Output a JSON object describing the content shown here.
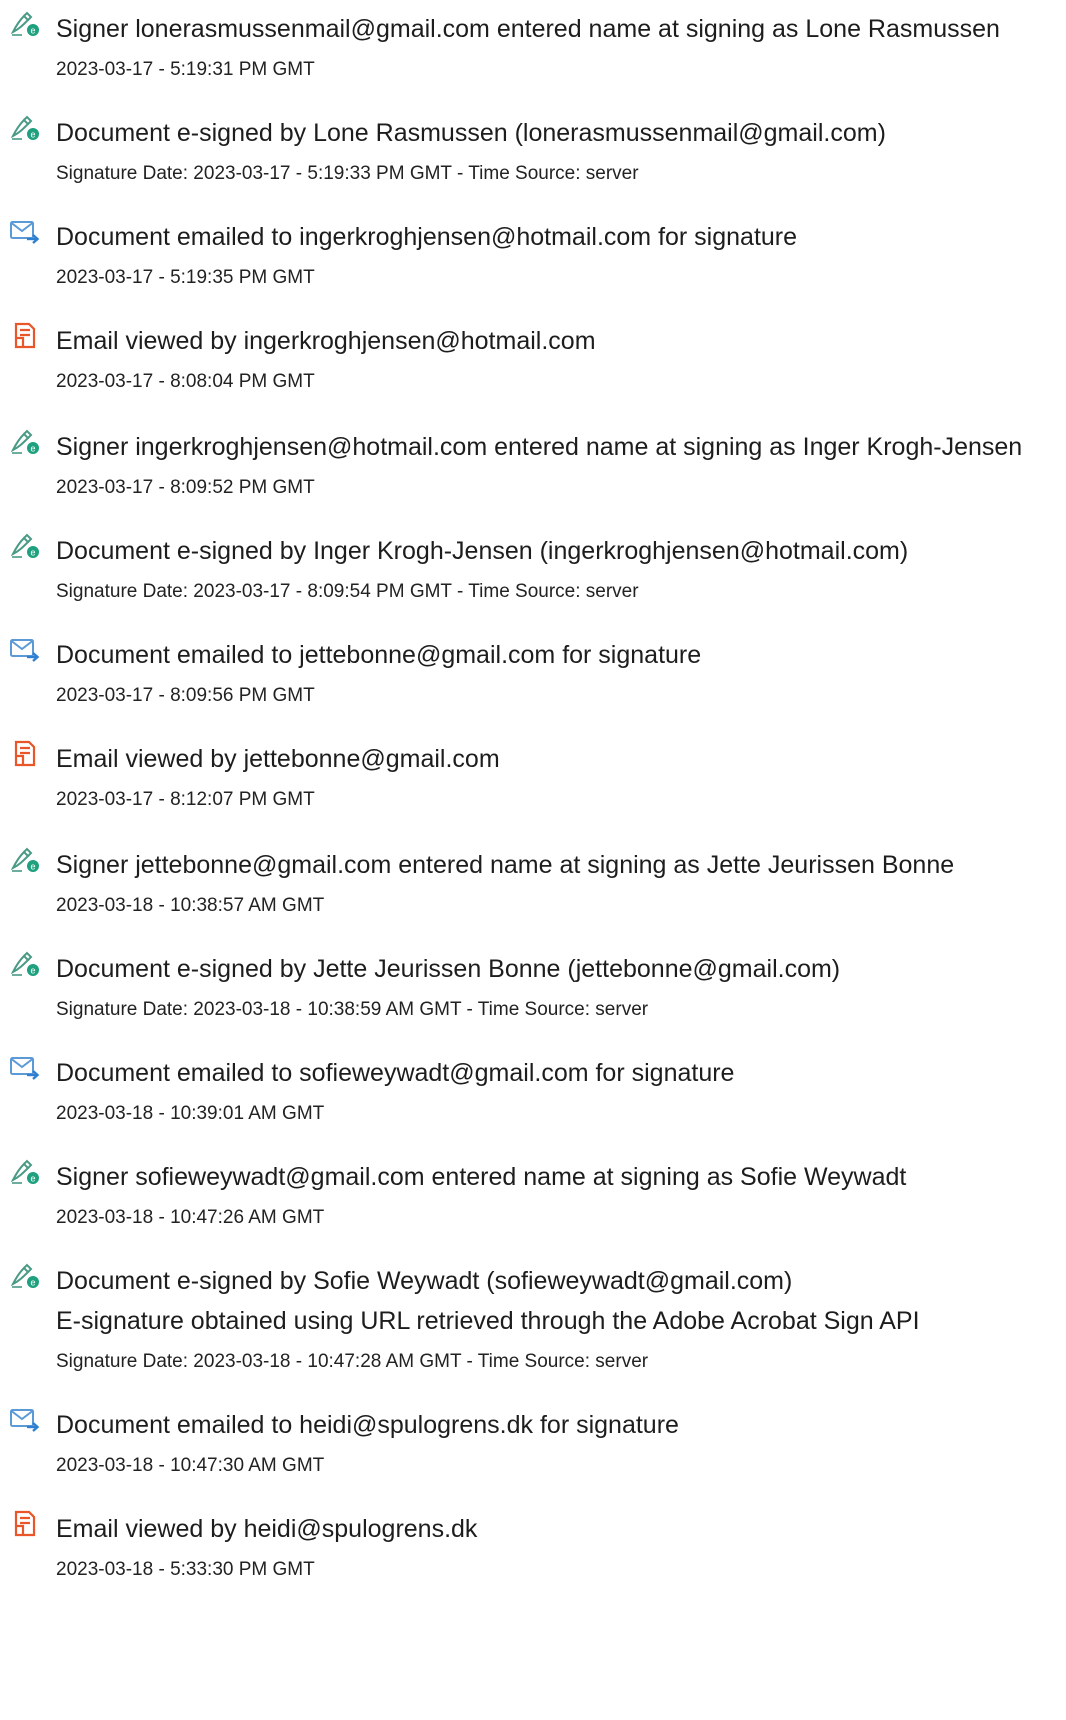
{
  "events": [
    {
      "icon": "sign-icon",
      "lines": [
        "Signer lonerasmussenmail@gmail.com entered name at signing as Lone Rasmussen"
      ],
      "meta": "2023-03-17 - 5:19:31 PM GMT"
    },
    {
      "icon": "sign-icon",
      "lines": [
        "Document e-signed by Lone Rasmussen (lonerasmussenmail@gmail.com)"
      ],
      "meta": "Signature Date: 2023-03-17 - 5:19:33 PM GMT - Time Source: server"
    },
    {
      "icon": "email-icon",
      "lines": [
        "Document emailed to ingerkroghjensen@hotmail.com for signature"
      ],
      "meta": "2023-03-17 - 5:19:35 PM GMT"
    },
    {
      "icon": "document-viewed-icon",
      "lines": [
        "Email viewed by ingerkroghjensen@hotmail.com"
      ],
      "meta": "2023-03-17 - 8:08:04 PM GMT"
    },
    {
      "icon": "sign-icon",
      "lines": [
        "Signer ingerkroghjensen@hotmail.com entered name at signing as Inger Krogh-Jensen"
      ],
      "meta": "2023-03-17 - 8:09:52 PM GMT"
    },
    {
      "icon": "sign-icon",
      "lines": [
        "Document e-signed by Inger Krogh-Jensen (ingerkroghjensen@hotmail.com)"
      ],
      "meta": "Signature Date: 2023-03-17 - 8:09:54 PM GMT - Time Source: server"
    },
    {
      "icon": "email-icon",
      "lines": [
        "Document emailed to jettebonne@gmail.com for signature"
      ],
      "meta": "2023-03-17 - 8:09:56 PM GMT"
    },
    {
      "icon": "document-viewed-icon",
      "lines": [
        "Email viewed by jettebonne@gmail.com"
      ],
      "meta": "2023-03-17 - 8:12:07 PM GMT"
    },
    {
      "icon": "sign-icon",
      "lines": [
        "Signer jettebonne@gmail.com entered name at signing as Jette Jeurissen Bonne"
      ],
      "meta": "2023-03-18 - 10:38:57 AM GMT"
    },
    {
      "icon": "sign-icon",
      "lines": [
        "Document e-signed by Jette Jeurissen Bonne (jettebonne@gmail.com)"
      ],
      "meta": "Signature Date: 2023-03-18 - 10:38:59 AM GMT - Time Source: server"
    },
    {
      "icon": "email-icon",
      "lines": [
        "Document emailed to sofieweywadt@gmail.com for signature"
      ],
      "meta": "2023-03-18 - 10:39:01 AM GMT"
    },
    {
      "icon": "sign-icon",
      "lines": [
        "Signer sofieweywadt@gmail.com entered name at signing as Sofie Weywadt"
      ],
      "meta": "2023-03-18 - 10:47:26 AM GMT"
    },
    {
      "icon": "sign-icon",
      "lines": [
        "Document e-signed by Sofie Weywadt (sofieweywadt@gmail.com)",
        "E-signature obtained using URL retrieved through the Adobe Acrobat Sign API"
      ],
      "meta": "Signature Date: 2023-03-18 - 10:47:28 AM GMT - Time Source: server"
    },
    {
      "icon": "email-icon",
      "lines": [
        "Document emailed to heidi@spulogrens.dk for signature"
      ],
      "meta": "2023-03-18 - 10:47:30 AM GMT"
    },
    {
      "icon": "document-viewed-icon",
      "lines": [
        "Email viewed by heidi@spulogrens.dk"
      ],
      "meta": "2023-03-18 - 5:33:30 PM GMT"
    }
  ],
  "colors": {
    "sign_pen": "#4a9a86",
    "sign_badge": "#1fa07e",
    "email": "#5b9ad6",
    "email_arrow": "#2f7fd1",
    "document_viewed": "#e8562a"
  }
}
